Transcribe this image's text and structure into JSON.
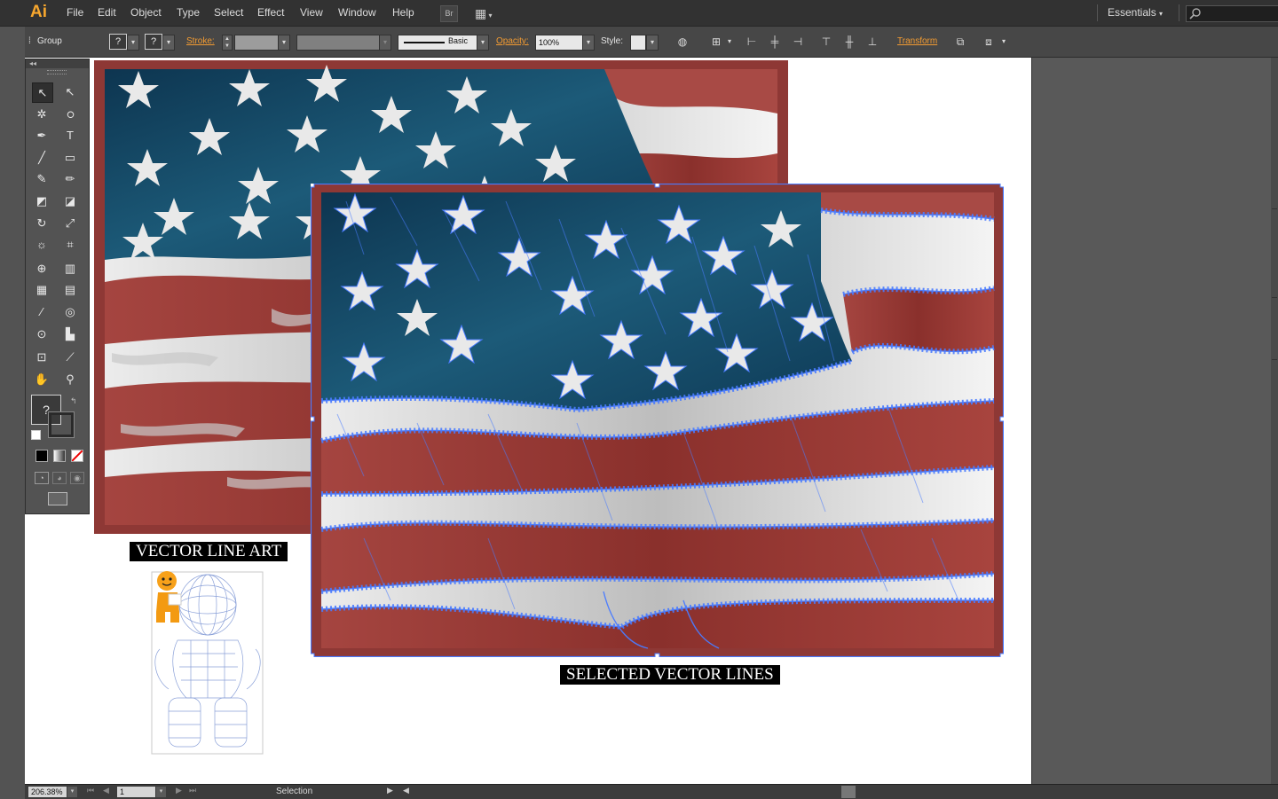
{
  "app": {
    "logo": "Ai"
  },
  "menu": [
    "File",
    "Edit",
    "Object",
    "Type",
    "Select",
    "Effect",
    "View",
    "Window",
    "Help"
  ],
  "menubar_buttons": {
    "bridge": "Br",
    "arrange": "▦"
  },
  "workspace": {
    "label": "Essentials",
    "search_icon": "search-icon"
  },
  "control": {
    "selection_type": "Group",
    "fill_question": "?",
    "stroke_question": "?",
    "stroke_label": "Stroke:",
    "brush_label": "Basic",
    "opacity_label": "Opacity:",
    "opacity_value": "100%",
    "style_label": "Style:",
    "transform_label": "Transform"
  },
  "toolbar": {
    "collapse": "◂◂",
    "fill_stroke_question": "?",
    "tools": [
      {
        "name": "selection-tool-icon",
        "glyph": "↖",
        "sel": true
      },
      {
        "name": "direct-selection-tool-icon",
        "glyph": "↖",
        "sel": false
      },
      {
        "name": "magic-wand-tool-icon",
        "glyph": "✲",
        "sel": false
      },
      {
        "name": "lasso-tool-icon",
        "glyph": "ഠ",
        "sel": false
      },
      {
        "name": "pen-tool-icon",
        "glyph": "✒",
        "sel": false
      },
      {
        "name": "type-tool-icon",
        "glyph": "T",
        "sel": false
      },
      {
        "name": "line-tool-icon",
        "glyph": "╱",
        "sel": false
      },
      {
        "name": "rectangle-tool-icon",
        "glyph": "▭",
        "sel": false
      },
      {
        "name": "paintbrush-tool-icon",
        "glyph": "✎",
        "sel": false
      },
      {
        "name": "pencil-tool-icon",
        "glyph": "✏",
        "sel": false
      },
      {
        "name": "blob-brush-tool-icon",
        "glyph": "◩",
        "sel": false
      },
      {
        "name": "eraser-tool-icon",
        "glyph": "◪",
        "sel": false
      },
      {
        "name": "rotate-tool-icon",
        "glyph": "↻",
        "sel": false
      },
      {
        "name": "scale-tool-icon",
        "glyph": "⤢",
        "sel": false
      },
      {
        "name": "warp-tool-icon",
        "glyph": "☼",
        "sel": false
      },
      {
        "name": "free-transform-tool-icon",
        "glyph": "⌗",
        "sel": false
      },
      {
        "name": "shape-builder-tool-icon",
        "glyph": "⊕",
        "sel": false
      },
      {
        "name": "perspective-grid-tool-icon",
        "glyph": "▥",
        "sel": false
      },
      {
        "name": "mesh-tool-icon",
        "glyph": "▦",
        "sel": false
      },
      {
        "name": "gradient-tool-icon",
        "glyph": "▤",
        "sel": false
      },
      {
        "name": "eyedropper-tool-icon",
        "glyph": "⁄",
        "sel": false
      },
      {
        "name": "blend-tool-icon",
        "glyph": "◎",
        "sel": false
      },
      {
        "name": "symbol-sprayer-tool-icon",
        "glyph": "⊙",
        "sel": false
      },
      {
        "name": "column-graph-tool-icon",
        "glyph": "▙",
        "sel": false
      },
      {
        "name": "artboard-tool-icon",
        "glyph": "⊡",
        "sel": false
      },
      {
        "name": "slice-tool-icon",
        "glyph": "⟋",
        "sel": false
      },
      {
        "name": "hand-tool-icon",
        "glyph": "✋",
        "sel": false
      },
      {
        "name": "zoom-tool-icon",
        "glyph": "⚲",
        "sel": false
      }
    ]
  },
  "captions": {
    "left": "VECTOR LINE ART",
    "right": "SELECTED VECTOR LINES"
  },
  "status": {
    "zoom": "206.38%",
    "artboard": "1",
    "tool": "Selection"
  },
  "colors": {
    "accent_orange": "#f29b32",
    "selection_blue": "#4a7cff",
    "flag_blue": "#0f3f5c",
    "flag_red": "#9a3a36"
  }
}
